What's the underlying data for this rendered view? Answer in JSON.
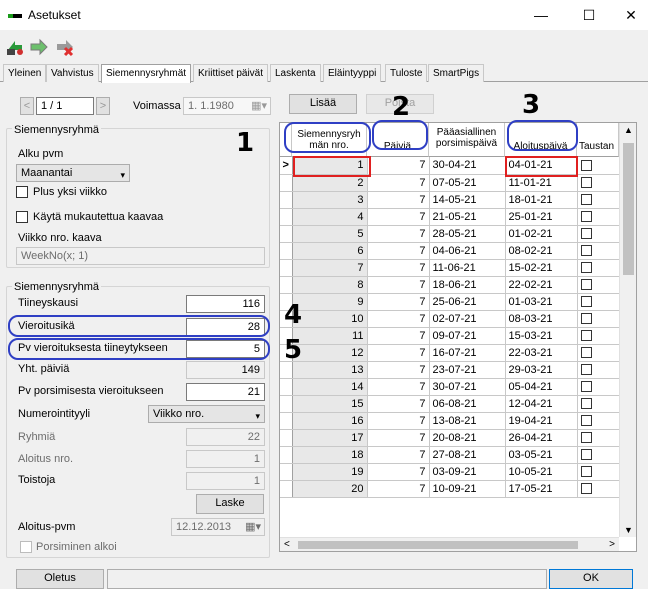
{
  "window": {
    "title": "Asetukset",
    "minimize": "—",
    "maximize": "☐",
    "close": "✕"
  },
  "toolbar": {
    "icons": [
      "refresh-icon",
      "forward-icon",
      "delete-icon"
    ]
  },
  "tabs": [
    "Yleinen",
    "Vahvistus",
    "Siemennysryhmät",
    "Kriittiset päivät",
    "Laskenta",
    "Eläintyyppi",
    "Tuloste",
    "SmartPigs"
  ],
  "active_tab": "Siemennysryhmät",
  "nav": {
    "record": "1 / 1",
    "voimassa_label": "Voimassa",
    "voimassa_value": "1. 1.1980",
    "lisaa": "Lisää",
    "poista": "Poista"
  },
  "group1": {
    "title": "Siemennysryhmä",
    "alku_label": "Alku pvm",
    "alku_value": "Maanantai",
    "plus_week": "Plus yksi viikko",
    "custom_formula": "Käytä mukautettua kaavaa",
    "week_formula_label": "Viikko nro. kaava",
    "week_formula_value": "WeekNo(x; 1)"
  },
  "group2": {
    "title": "Siemennysryhmä",
    "fields": [
      {
        "label": "Tiineyskausi",
        "value": "116"
      },
      {
        "label": "Vieroitusikä",
        "value": "28"
      },
      {
        "label": "Pv vieroituksesta tiineytykseen",
        "value": "5"
      },
      {
        "label": "Yht. päiviä",
        "value": "149"
      },
      {
        "label": "Pv porsimisesta vieroitukseen",
        "value": "21"
      }
    ],
    "numbering_label": "Numerointityyli",
    "numbering_value": "Viikko nro.",
    "ryhmia_label": "Ryhmiä",
    "ryhmia_value": "22",
    "aloitus_label": "Aloitus nro.",
    "aloitus_value": "1",
    "toistoja_label": "Toistoja",
    "toistoja_value": "1",
    "laske": "Laske",
    "aloitus_pvm_label": "Aloitus-pvm",
    "aloitus_pvm_value": "12.12.2013",
    "porsiminen": "Porsiminen alkoi"
  },
  "grid": {
    "headers": [
      "Siemennysryh män nro.",
      "Päiviä",
      "Pääasiallinen porsimispäivä",
      "Aloituspäivä",
      "Taustan"
    ],
    "rows": [
      [
        "1",
        "7",
        "30-04-21",
        "04-01-21"
      ],
      [
        "2",
        "7",
        "07-05-21",
        "11-01-21"
      ],
      [
        "3",
        "7",
        "14-05-21",
        "18-01-21"
      ],
      [
        "4",
        "7",
        "21-05-21",
        "25-01-21"
      ],
      [
        "5",
        "7",
        "28-05-21",
        "01-02-21"
      ],
      [
        "6",
        "7",
        "04-06-21",
        "08-02-21"
      ],
      [
        "7",
        "7",
        "11-06-21",
        "15-02-21"
      ],
      [
        "8",
        "7",
        "18-06-21",
        "22-02-21"
      ],
      [
        "9",
        "7",
        "25-06-21",
        "01-03-21"
      ],
      [
        "10",
        "7",
        "02-07-21",
        "08-03-21"
      ],
      [
        "11",
        "7",
        "09-07-21",
        "15-03-21"
      ],
      [
        "12",
        "7",
        "16-07-21",
        "22-03-21"
      ],
      [
        "13",
        "7",
        "23-07-21",
        "29-03-21"
      ],
      [
        "14",
        "7",
        "30-07-21",
        "05-04-21"
      ],
      [
        "15",
        "7",
        "06-08-21",
        "12-04-21"
      ],
      [
        "16",
        "7",
        "13-08-21",
        "19-04-21"
      ],
      [
        "17",
        "7",
        "20-08-21",
        "26-04-21"
      ],
      [
        "18",
        "7",
        "27-08-21",
        "03-05-21"
      ],
      [
        "19",
        "7",
        "03-09-21",
        "10-05-21"
      ],
      [
        "20",
        "7",
        "10-09-21",
        "17-05-21"
      ]
    ],
    "current_row_marker": ">"
  },
  "annotations": [
    "1",
    "2",
    "3",
    "4",
    "5"
  ],
  "footer": {
    "oletus": "Oletus",
    "ok": "OK"
  },
  "colors": {
    "annotation_oval": "#2f3fc4",
    "annotation_box": "#e02020"
  }
}
